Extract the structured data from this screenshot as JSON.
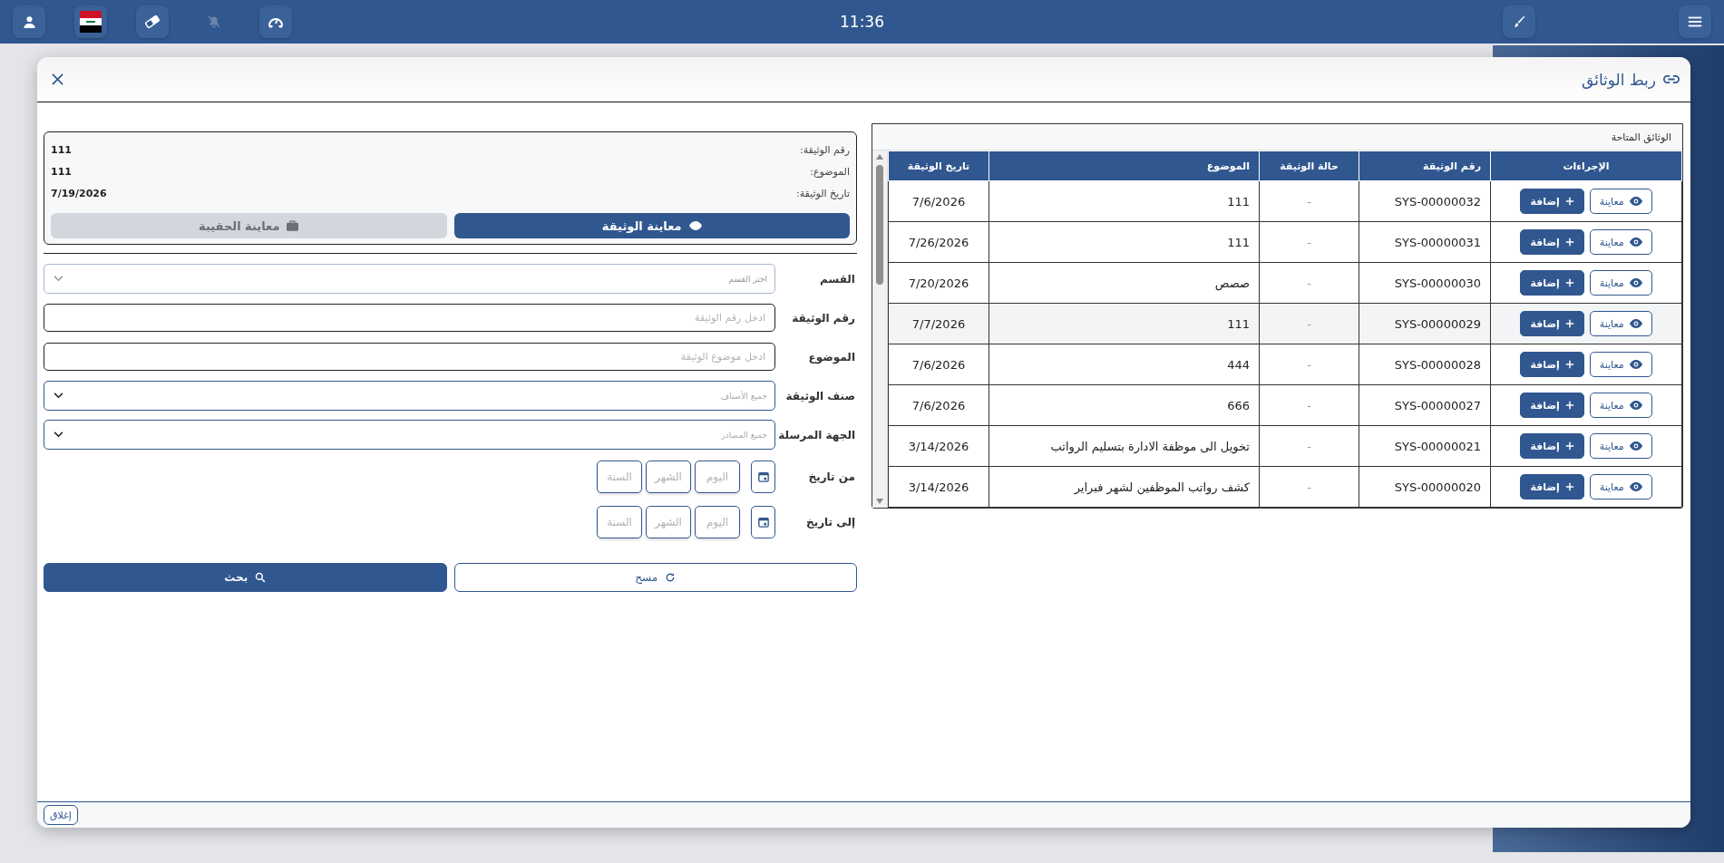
{
  "top_bar": {
    "time": "11:36",
    "left_tools": [
      {
        "kind": "user",
        "disabled": false
      },
      {
        "kind": "flag",
        "disabled": false
      },
      {
        "kind": "eraser",
        "disabled": false
      },
      {
        "kind": "mute",
        "disabled": true
      },
      {
        "kind": "gauge",
        "disabled": false
      }
    ],
    "right_tools": [
      {
        "kind": "brush",
        "disabled": false
      },
      {
        "kind": "menu",
        "disabled": false
      }
    ]
  },
  "dialog": {
    "title": "ربط الوثائق",
    "table": {
      "title": "الوثائق المتاحة",
      "columns": [
        "الإجراءات",
        "رقم الوثيقة",
        "حالة الوثيقة",
        "الموضوع",
        "تاريخ الوثيقة"
      ],
      "rows": [
        {
          "actions": [
            {
              "kind": "view",
              "label": "معاينة"
            },
            {
              "kind": "add",
              "label": "إضافة"
            }
          ],
          "number": "SYS-00000032",
          "status": "-",
          "subject": "111",
          "date": "7/6/2026",
          "hovered": false
        },
        {
          "actions": [
            {
              "kind": "view",
              "label": "معاينة"
            },
            {
              "kind": "add",
              "label": "إضافة"
            }
          ],
          "number": "SYS-00000031",
          "status": "-",
          "subject": "111",
          "date": "7/26/2026",
          "hovered": false
        },
        {
          "actions": [
            {
              "kind": "view",
              "label": "معاينة"
            },
            {
              "kind": "add",
              "label": "إضافة"
            }
          ],
          "number": "SYS-00000030",
          "status": "-",
          "subject": "صصص",
          "date": "7/20/2026",
          "hovered": false
        },
        {
          "actions": [
            {
              "kind": "view",
              "label": "معاينة"
            },
            {
              "kind": "add",
              "label": "إضافة"
            }
          ],
          "number": "SYS-00000029",
          "status": "-",
          "subject": "111",
          "date": "7/7/2026",
          "hovered": true
        },
        {
          "actions": [
            {
              "kind": "view",
              "label": "معاينة"
            },
            {
              "kind": "add",
              "label": "إضافة"
            }
          ],
          "number": "SYS-00000028",
          "status": "-",
          "subject": "444",
          "date": "7/6/2026",
          "hovered": false
        },
        {
          "actions": [
            {
              "kind": "view",
              "label": "معاينة"
            },
            {
              "kind": "add",
              "label": "إضافة"
            }
          ],
          "number": "SYS-00000027",
          "status": "-",
          "subject": "666",
          "date": "7/6/2026",
          "hovered": false
        },
        {
          "actions": [
            {
              "kind": "view",
              "label": "معاينة"
            },
            {
              "kind": "add",
              "label": "إضافة"
            }
          ],
          "number": "SYS-00000021",
          "status": "-",
          "subject": "تخويل الى موظفة الادارة بتسليم الرواتب",
          "date": "3/14/2026",
          "hovered": false
        },
        {
          "actions": [
            {
              "kind": "view",
              "label": "معاينة"
            },
            {
              "kind": "add",
              "label": "إضافة"
            }
          ],
          "number": "SYS-00000020",
          "status": "-",
          "subject": "كشف رواتب الموظفين لشهر فبراير",
          "date": "3/14/2026",
          "hovered": false
        }
      ]
    },
    "selected_document": {
      "fields": [
        {
          "label": "رقم الوثيقة:",
          "value": "111"
        },
        {
          "label": "الموضوع:",
          "value": "111"
        },
        {
          "label": "تاريخ الوثيقة:",
          "value": "7/19/2026"
        }
      ],
      "buttons": [
        {
          "kind": "view",
          "label": "معاينة الوثيقة",
          "disabled": false
        },
        {
          "kind": "bag",
          "label": "معاينة الحقيبة",
          "disabled": true
        }
      ]
    },
    "filters": [
      {
        "kind": "select",
        "label": "القسم",
        "placeholder": "اختر القسم",
        "disabled": true
      },
      {
        "kind": "text",
        "label": "رقم الوثيقة",
        "placeholder": "ادخل رقم الوثيقة"
      },
      {
        "kind": "text",
        "label": "الموضوع",
        "placeholder": "ادخل موضوع الوثيقة"
      },
      {
        "kind": "select",
        "label": "صنف الوثيقة",
        "placeholder": "جميع الأصناف",
        "disabled": false
      },
      {
        "kind": "select",
        "label": "الجهة المرسلة",
        "placeholder": "جميع المصادر",
        "disabled": false
      },
      {
        "kind": "date",
        "label": "من تاريخ",
        "placeholders": [
          "اليوم",
          "الشهر",
          "السنة"
        ]
      },
      {
        "kind": "date",
        "label": "إلى تاريخ",
        "placeholders": [
          "اليوم",
          "الشهر",
          "السنة"
        ]
      }
    ],
    "actions": [
      {
        "kind": "clear",
        "label": "مسح"
      },
      {
        "kind": "search",
        "label": "بحث"
      }
    ],
    "footer": {
      "close_label": "إغلاق"
    }
  }
}
